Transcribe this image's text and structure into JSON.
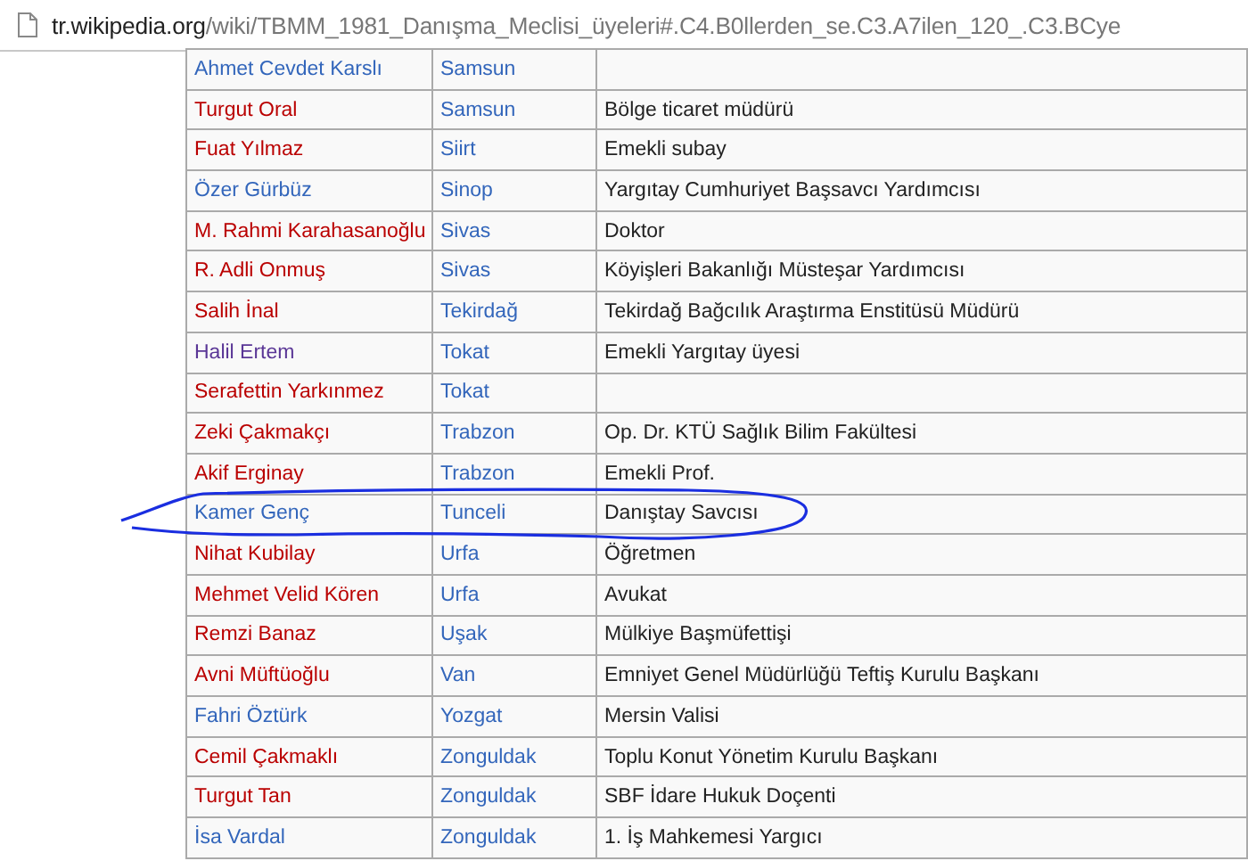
{
  "address_bar": {
    "host": "tr.wikipedia.org",
    "path": "/wiki/TBMM_1981_Danışma_Meclisi_üyeleri#.C4.B0llerden_se.C3.A7ilen_120_.C3.BCye"
  },
  "table": {
    "rows": [
      {
        "name": "Ahmet Cevdet Karslı",
        "color": "#3366bb",
        "province": "Samsun",
        "job": ""
      },
      {
        "name": "Turgut Oral",
        "color": "#ba0000",
        "province": "Samsun",
        "job": "Bölge ticaret müdürü"
      },
      {
        "name": "Fuat Yılmaz",
        "color": "#ba0000",
        "province": "Siirt",
        "job": "Emekli subay"
      },
      {
        "name": "Özer Gürbüz",
        "color": "#3366bb",
        "province": "Sinop",
        "job": "Yargıtay Cumhuriyet Başsavcı Yardımcısı"
      },
      {
        "name": "M. Rahmi Karahasanoğlu",
        "color": "#ba0000",
        "province": "Sivas",
        "job": "Doktor"
      },
      {
        "name": "R. Adli Onmuş",
        "color": "#ba0000",
        "province": "Sivas",
        "job": "Köyişleri Bakanlığı Müsteşar Yardımcısı"
      },
      {
        "name": "Salih İnal",
        "color": "#ba0000",
        "province": "Tekirdağ",
        "job": "Tekirdağ Bağcılık Araştırma Enstitüsü Müdürü"
      },
      {
        "name": "Halil Ertem",
        "color": "#5a3696",
        "province": "Tokat",
        "job": "Emekli Yargıtay üyesi"
      },
      {
        "name": "Serafettin Yarkınmez",
        "color": "#ba0000",
        "province": "Tokat",
        "job": ""
      },
      {
        "name": "Zeki Çakmakçı",
        "color": "#ba0000",
        "province": "Trabzon",
        "job": "Op. Dr. KTÜ Sağlık Bilim Fakültesi"
      },
      {
        "name": "Akif Erginay",
        "color": "#ba0000",
        "province": "Trabzon",
        "job": "Emekli Prof."
      },
      {
        "name": "Kamer Genç",
        "color": "#3366bb",
        "province": "Tunceli",
        "job": "Danıştay Savcısı"
      },
      {
        "name": "Nihat Kubilay",
        "color": "#ba0000",
        "province": "Urfa",
        "job": "Öğretmen"
      },
      {
        "name": "Mehmet Velid Kören",
        "color": "#ba0000",
        "province": "Urfa",
        "job": "Avukat"
      },
      {
        "name": "Remzi Banaz",
        "color": "#ba0000",
        "province": "Uşak",
        "job": "Mülkiye Başmüfettişi"
      },
      {
        "name": "Avni Müftüoğlu",
        "color": "#ba0000",
        "province": "Van",
        "job": "Emniyet Genel Müdürlüğü Teftiş Kurulu Başkanı"
      },
      {
        "name": "Fahri Öztürk",
        "color": "#3366bb",
        "province": "Yozgat",
        "job": "Mersin Valisi"
      },
      {
        "name": "Cemil Çakmaklı",
        "color": "#ba0000",
        "province": "Zonguldak",
        "job": "Toplu Konut Yönetim Kurulu Başkanı"
      },
      {
        "name": "Turgut Tan",
        "color": "#ba0000",
        "province": "Zonguldak",
        "job": "SBF İdare Hukuk Doçenti"
      },
      {
        "name": "İsa Vardal",
        "color": "#3366bb",
        "province": "Zonguldak",
        "job": "1. İş Mahkemesi Yargıcı"
      }
    ]
  }
}
